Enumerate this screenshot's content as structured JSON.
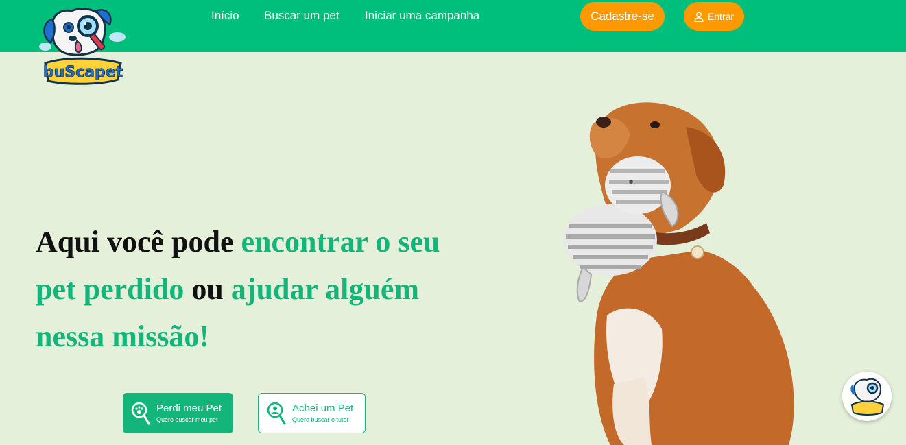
{
  "nav": {
    "links": [
      "Início",
      "Buscar um pet",
      "Iniciar uma campanha"
    ],
    "register_label": "Cadastre-se",
    "login_label": "Entrar"
  },
  "logo": {
    "text": "buScapet"
  },
  "hero": {
    "part1": "Aqui você pode ",
    "part2": "encontrar o seu pet perdido",
    "part3": " ou ",
    "part4": "ajudar alguém nessa missão!"
  },
  "actions": {
    "lost": {
      "label": "Perdi meu Pet",
      "sublabel": "Quero buscar meu pet"
    },
    "found": {
      "label": "Achei um Pet",
      "sublabel": "Quero buscar o tutor"
    }
  },
  "colors": {
    "nav_bg": "#00bf7d",
    "accent_green": "#14b57b",
    "orange": "#ff9900",
    "page_bg": "#e5f0da"
  },
  "icons": [
    "logo-dog-magnifier",
    "user-icon",
    "paw-search-icon",
    "person-search-icon"
  ]
}
